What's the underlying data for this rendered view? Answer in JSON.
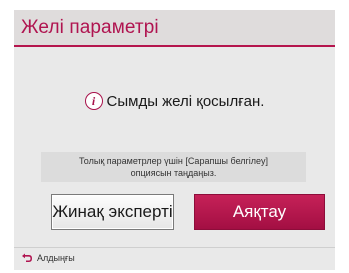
{
  "dialog": {
    "title": "Желі параметрі",
    "message": "Сымды желі қосылған.",
    "hint_lines": [
      "Толық параметрлер үшін [Сарапшы белгілеу]",
      "опциясын таңдаңыз."
    ],
    "buttons": {
      "expert_label": "Жинақ эксперті",
      "finish_label": "Аяқтау"
    },
    "footer": {
      "back_label": "Алдыңғы",
      "back_icon": "back-arrow-icon"
    },
    "info_icon": "info-icon",
    "colors": {
      "accent": "#b01450",
      "focused_button": "#b5154d",
      "background": "#e9e9e9"
    }
  }
}
